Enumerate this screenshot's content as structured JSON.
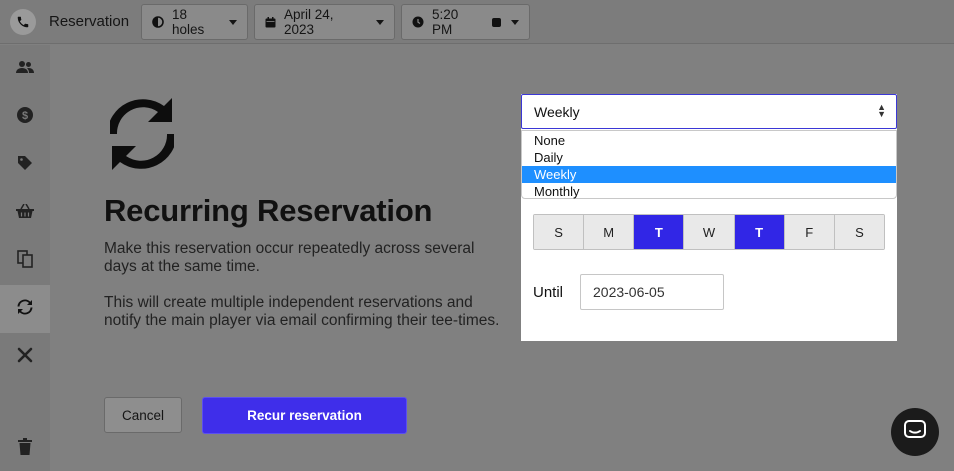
{
  "header": {
    "title": "Reservation",
    "holes": "18 holes",
    "date": "April 24, 2023",
    "time": "5:20 PM"
  },
  "sidebar": {
    "items": [
      {
        "icon": "users-icon"
      },
      {
        "icon": "dollar-icon"
      },
      {
        "icon": "tag-icon"
      },
      {
        "icon": "basket-icon"
      },
      {
        "icon": "copy-icon"
      },
      {
        "icon": "recur-icon",
        "active": true
      },
      {
        "icon": "cross-icon"
      },
      {
        "icon": "trash-icon"
      }
    ]
  },
  "main": {
    "heading": "Recurring Reservation",
    "desc1": "Make this reservation occur repeatedly across several days at the same time.",
    "desc2": "This will create multiple independent reservations and notify the main player via email confirming their tee-times.",
    "cancel_label": "Cancel",
    "recur_label": "Recur reservation"
  },
  "recurrence": {
    "selected": "Weekly",
    "options": [
      "None",
      "Daily",
      "Weekly",
      "Monthly"
    ],
    "days": [
      {
        "label": "S",
        "on": false
      },
      {
        "label": "M",
        "on": false
      },
      {
        "label": "T",
        "on": true
      },
      {
        "label": "W",
        "on": false
      },
      {
        "label": "T",
        "on": true
      },
      {
        "label": "F",
        "on": false
      },
      {
        "label": "S",
        "on": false
      }
    ],
    "until_label": "Until",
    "until_value": "2023-06-05"
  },
  "colors": {
    "accent": "#3f2eea",
    "selected_option": "#1e8fff",
    "overlay": "#808080"
  }
}
